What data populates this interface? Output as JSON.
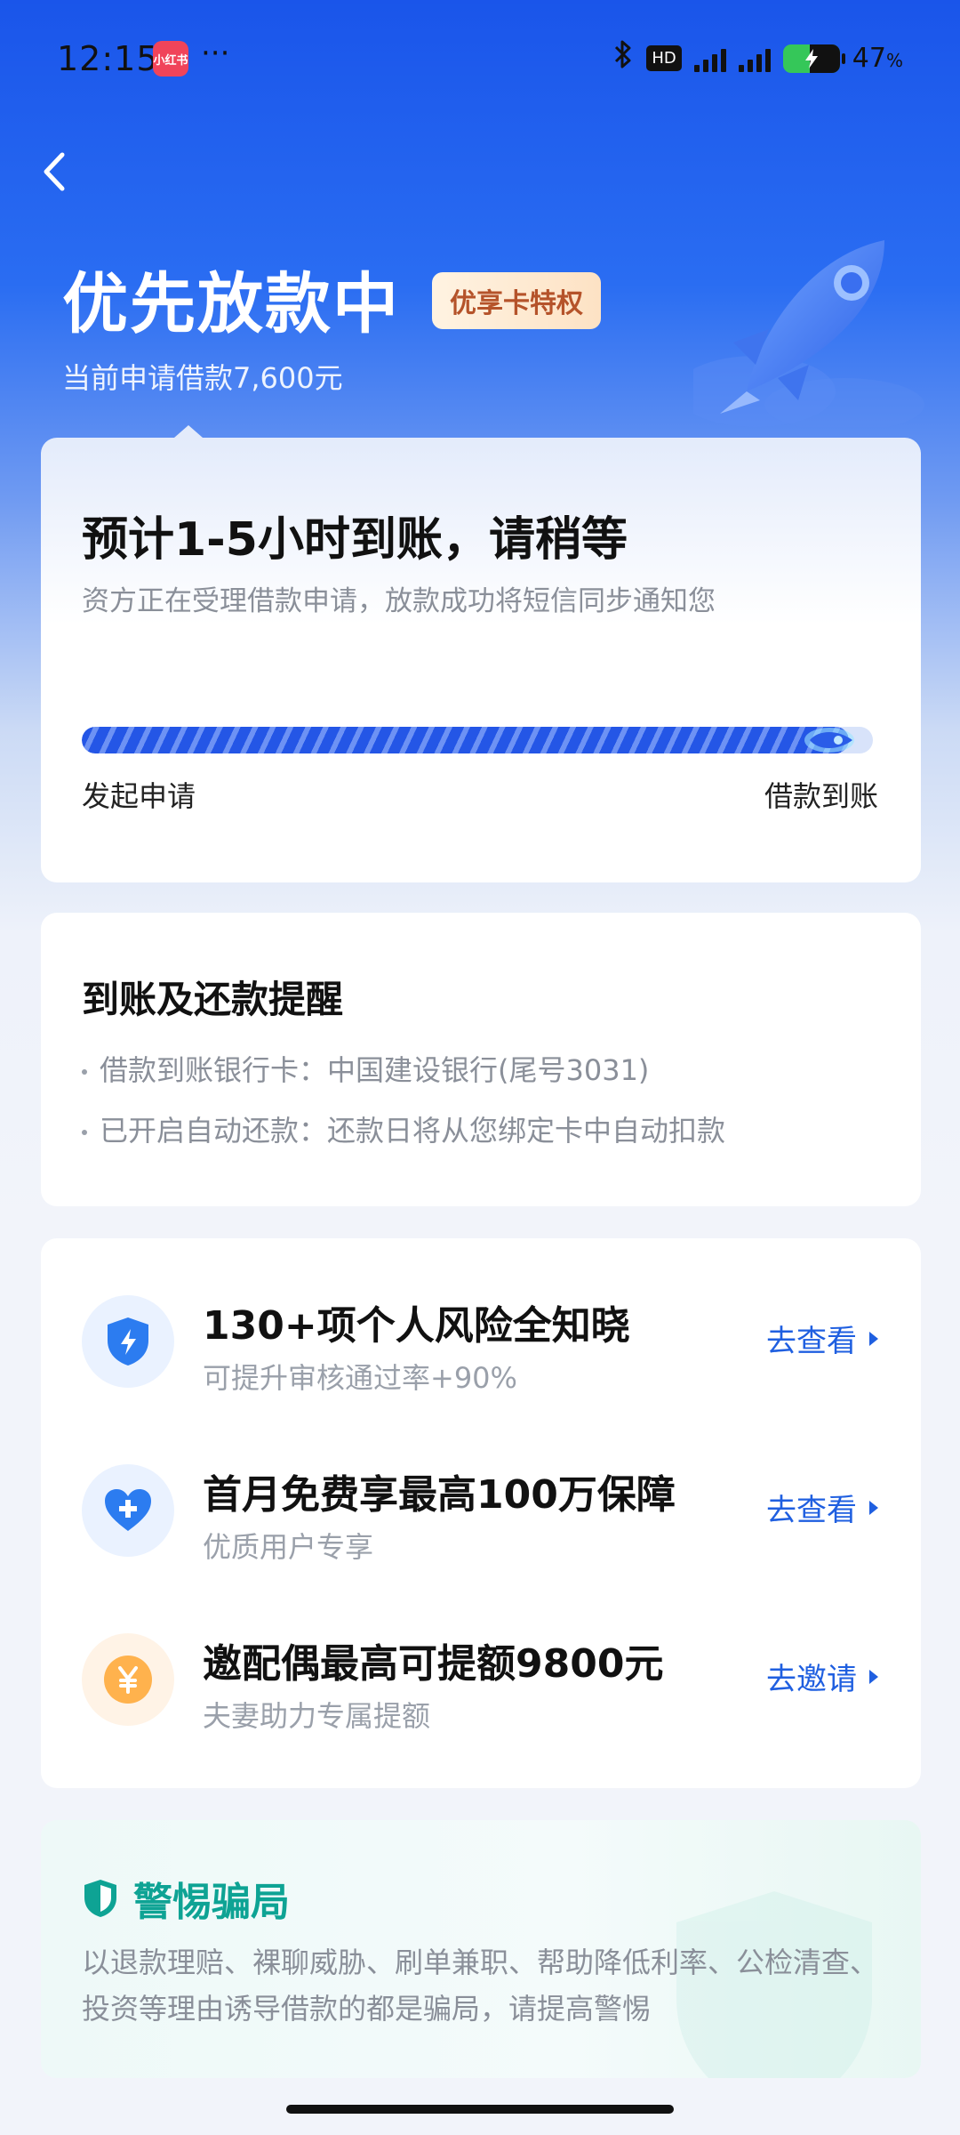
{
  "status_bar": {
    "time": "12:15",
    "app_badge": "小红书",
    "more": "···",
    "hd": "HD",
    "battery_percent": "47",
    "battery_suffix": "%",
    "battery_level": 0.47
  },
  "header": {
    "title": "优先放款中",
    "badge": "优享卡特权",
    "subtitle": "当前申请借款7,600元"
  },
  "progress_card": {
    "title": "预计1-5小时到账，请稍等",
    "subtitle": "资方正在受理借款申请，放款成功将短信同步通知您",
    "progress": 0.97,
    "start_label": "发起申请",
    "end_label": "借款到账"
  },
  "reminder_card": {
    "title": "到账及还款提醒",
    "items": [
      "借款到账银行卡：中国建设银行(尾号3031)",
      "已开启自动还款：还款日将从您绑定卡中自动扣款"
    ]
  },
  "services": [
    {
      "title": "130+项个人风险全知晓",
      "subtitle": "可提升审核通过率+90%",
      "action": "去查看",
      "icon": "shield-bolt-icon"
    },
    {
      "title": "首月免费享最高100万保障",
      "subtitle": "优质用户专享",
      "action": "去查看",
      "icon": "heart-plus-icon"
    },
    {
      "title": "邀配偶最高可提额9800元",
      "subtitle": "夫妻助力专属提额",
      "action": "去邀请",
      "icon": "yuan-coin-icon"
    }
  ],
  "fraud_warning": {
    "title": "警惕骗局",
    "text": "以退款理赔、裸聊威胁、刷单兼职、帮助降低利率、公检清查、投资等理由诱导借款的都是骗局，请提高警惕"
  },
  "colors": {
    "header_blue": "#1a55ea",
    "action_blue": "#1f5fe0",
    "warning_teal": "#0ea394",
    "badge_text": "#b5532a"
  }
}
